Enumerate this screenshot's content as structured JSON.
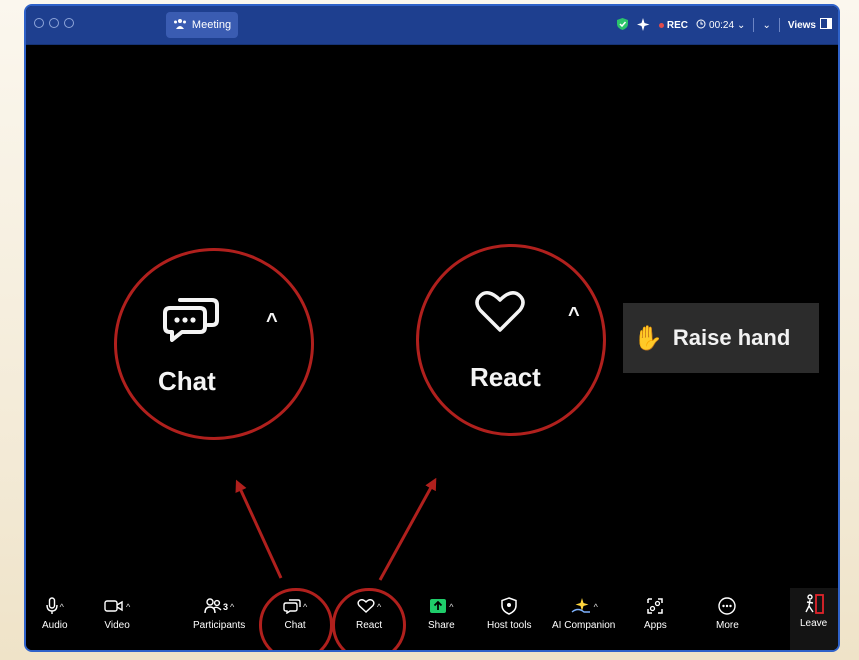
{
  "titlebar": {
    "meeting_label": "Meeting",
    "rec_label": "REC",
    "timer": "00:24",
    "views_label": "Views"
  },
  "zoomed": {
    "chat_label": "Chat",
    "react_label": "React",
    "raise_hand_label": "Raise hand"
  },
  "toolbar": {
    "audio": "Audio",
    "video": "Video",
    "participants": "Participants",
    "participants_count": "3",
    "chat": "Chat",
    "react": "React",
    "share": "Share",
    "host_tools": "Host tools",
    "ai_companion": "AI Companion",
    "apps": "Apps",
    "more": "More",
    "leave": "Leave"
  },
  "colors": {
    "titlebar": "#1e3f8f",
    "annotation_red": "#b0201d",
    "share_green": "#1fcc6a",
    "leave_red": "#e0242b"
  }
}
